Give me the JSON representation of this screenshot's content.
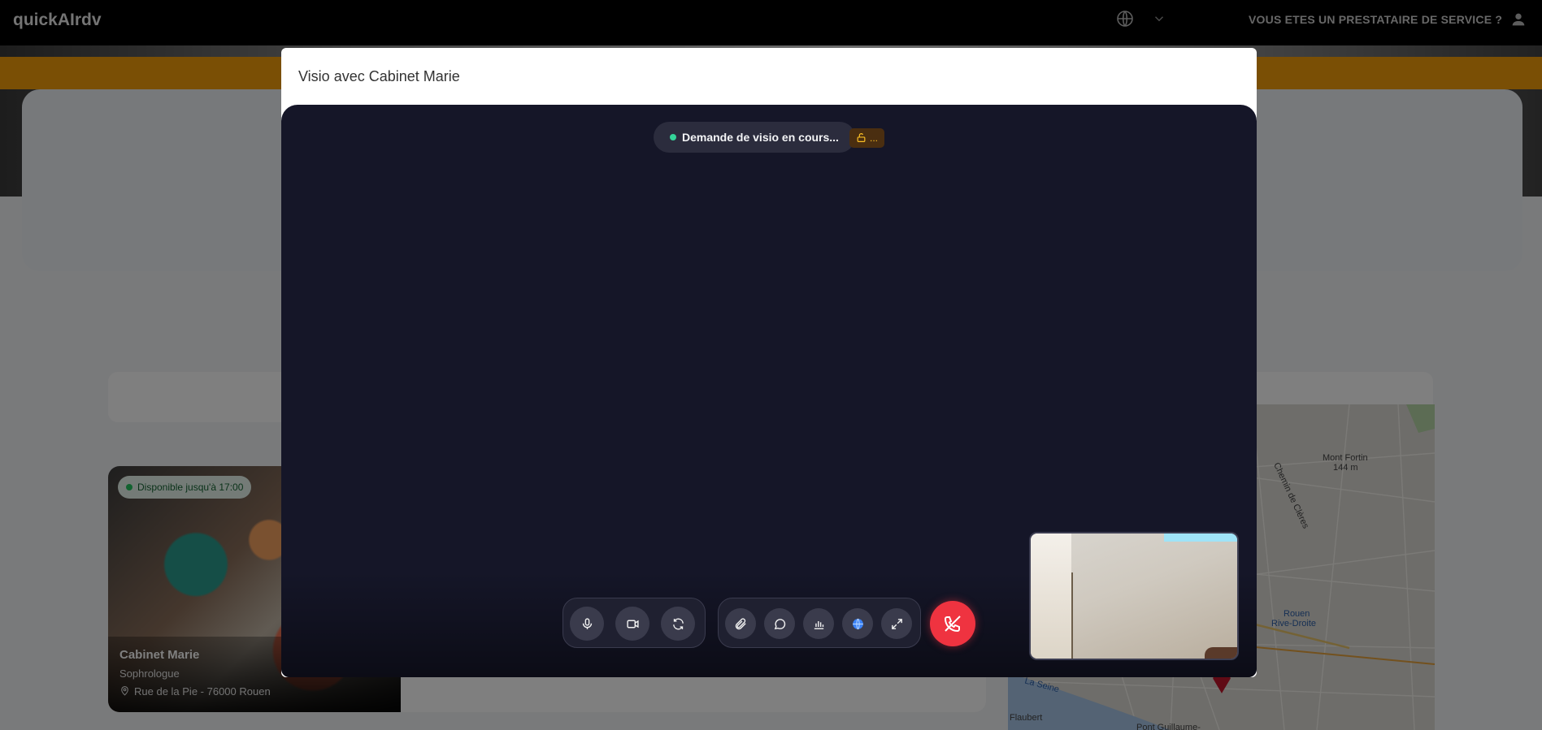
{
  "header": {
    "brand": "quickAIrdv",
    "provider_link": "VOUS ETES UN PRESTATAIRE DE SERVICE ?"
  },
  "listing": {
    "availability": "Disponible jusqu'à 17:00",
    "name": "Cabinet Marie",
    "category": "Sophrologue",
    "address": "Rue de la Pie - 76000 Rouen"
  },
  "map": {
    "labels": [
      "Mont Fortin",
      "144 m",
      "Chemin de Clères",
      "Rouen",
      "Rive-Droite",
      "La Seine",
      "Flaubert",
      "Pont Guillaume-"
    ]
  },
  "modal": {
    "title": "Visio avec Cabinet Marie",
    "status": "Demande de visio en cours...",
    "lock_text": "..."
  },
  "controls": {
    "media": [
      "microphone",
      "camera",
      "switch-camera"
    ],
    "tools": [
      "attachment",
      "chat",
      "stats",
      "translate",
      "fullscreen"
    ]
  },
  "colors": {
    "stage_bg": "#151628",
    "end_call": "#ef3340",
    "status_dot": "#34d399",
    "header_bg": "#000000",
    "accent_orange": "#f59e0b"
  }
}
